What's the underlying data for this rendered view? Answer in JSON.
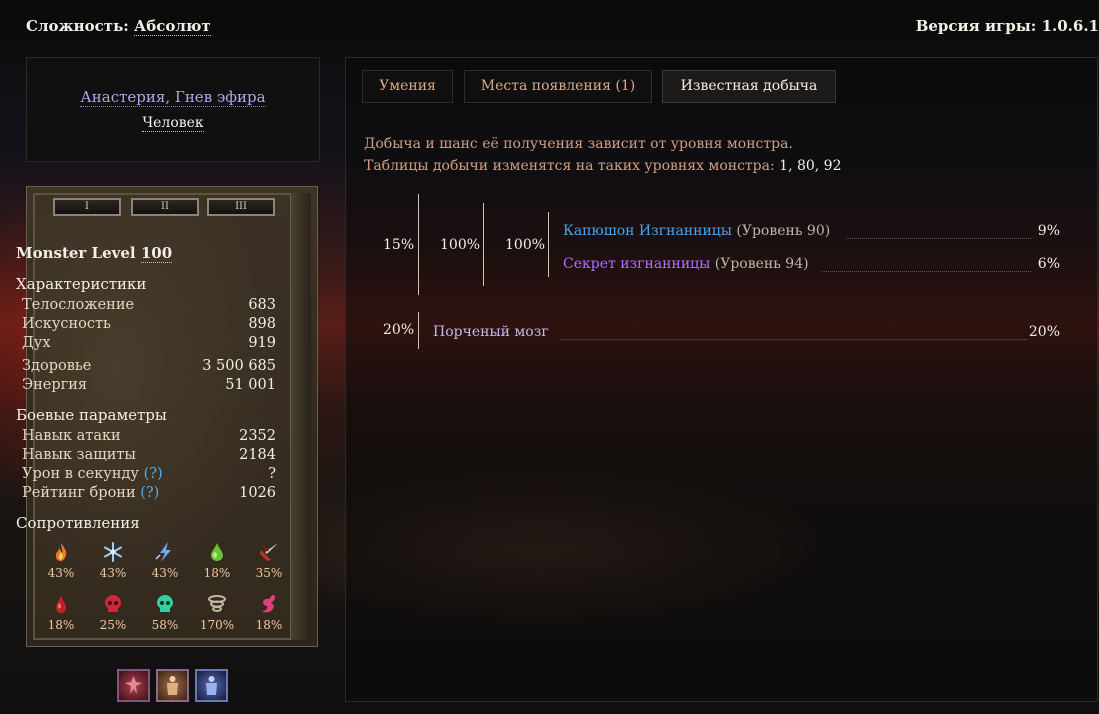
{
  "header": {
    "difficulty_label": "Сложность:",
    "difficulty_value": "Абсолют",
    "version_label": "Версия игры:",
    "version_value": "1.0.6.1"
  },
  "monster": {
    "name": "Анастерия, Гнев эфира",
    "race": "Человек",
    "tab_labels": [
      "I",
      "II",
      "III"
    ],
    "level_label": "Monster Level",
    "level_value": "100",
    "stats_title": "Характеристики",
    "stats": [
      {
        "label": "Телосложение",
        "value": "683"
      },
      {
        "label": "Искусность",
        "value": "898"
      },
      {
        "label": "Дух",
        "value": "919"
      },
      {
        "label": "Здоровье",
        "value": "3 500 685"
      },
      {
        "label": "Энергия",
        "value": "51 001"
      }
    ],
    "combat_title": "Боевые параметры",
    "combat": [
      {
        "label": "Навык атаки",
        "value": "2352",
        "help": ""
      },
      {
        "label": "Навык защиты",
        "value": "2184",
        "help": ""
      },
      {
        "label": "Урон в секунду",
        "value": "?",
        "help": "(?)"
      },
      {
        "label": "Рейтинг брони",
        "value": "1026",
        "help": "(?)"
      }
    ],
    "resist_title": "Сопротивления",
    "resistances": [
      {
        "icon": "fire-resist-icon",
        "value": "43%",
        "color": "#e8782a"
      },
      {
        "icon": "cold-resist-icon",
        "value": "43%",
        "color": "#9fd0ff"
      },
      {
        "icon": "lightning-resist-icon",
        "value": "43%",
        "color": "#6fa8ff"
      },
      {
        "icon": "poison-resist-icon",
        "value": "18%",
        "color": "#6ac23a"
      },
      {
        "icon": "pierce-resist-icon",
        "value": "35%",
        "color": "#c03028"
      },
      {
        "icon": "bleed-resist-icon",
        "value": "18%",
        "color": "#c0202a"
      },
      {
        "icon": "vitality-resist-icon",
        "value": "25%",
        "color": "#d02838"
      },
      {
        "icon": "aether-resist-icon",
        "value": "58%",
        "color": "#30d0a0"
      },
      {
        "icon": "stun-resist-icon",
        "value": "170%",
        "color": "#c0b8a0"
      },
      {
        "icon": "chaos-resist-icon",
        "value": "18%",
        "color": "#e0407a"
      }
    ]
  },
  "skills": [
    {
      "icon": "skill-red-icon",
      "color": "#7a2030"
    },
    {
      "icon": "skill-brown-icon",
      "color": "#7a5030"
    },
    {
      "icon": "skill-blue-icon",
      "color": "#3a4a8a"
    }
  ],
  "content": {
    "tabs": [
      {
        "label": "Умения",
        "active": false
      },
      {
        "label": "Места появления (1)",
        "active": false
      },
      {
        "label": "Известная добыча",
        "active": true
      }
    ],
    "info_line1": "Добыча и шанс её получения зависит от уровня монстра.",
    "info_line2": "Таблицы добычи изменятся на таких уровнях монстра:",
    "info_levels": "1, 80, 92",
    "loot": [
      {
        "pcts": [
          "15%",
          "100%",
          "100%"
        ],
        "items": [
          {
            "name": "Капюшон Изгнанницы",
            "level": "(Уровень 90)",
            "chance": "9%",
            "color": "#4aa3e8"
          },
          {
            "name": "Секрет изгнанницы",
            "level": "(Уровень 94)",
            "chance": "6%",
            "color": "#b070ff"
          }
        ]
      },
      {
        "pcts": [
          "20%"
        ],
        "items": [
          {
            "name": "Порченый мозг",
            "level": "",
            "chance": "20%",
            "color": "#c9b7e6"
          }
        ]
      }
    ]
  }
}
